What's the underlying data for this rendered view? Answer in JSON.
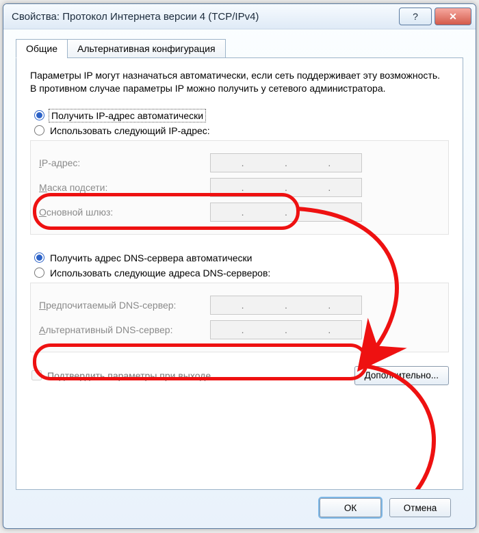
{
  "window": {
    "title": "Свойства: Протокол Интернета версии 4 (TCP/IPv4)"
  },
  "tabs": {
    "general": "Общие",
    "alt": "Альтернативная конфигурация"
  },
  "intro": "Параметры IP могут назначаться автоматически, если сеть поддерживает эту возможность. В противном случае параметры IP можно получить у сетевого администратора.",
  "ip": {
    "auto_label_pre": "П",
    "auto_label_rest": "олучить IP-адрес автоматически",
    "manual_label_pre": "И",
    "manual_label_rest": "спользовать следующий IP-адрес:",
    "ip_label_pre": "I",
    "ip_label_rest": "P-адрес:",
    "mask_label_pre": "М",
    "mask_label_rest": "аска подсети:",
    "gw_label_pre": "О",
    "gw_label_rest": "сновной шлюз:"
  },
  "dns": {
    "auto_label_pre": "П",
    "auto_label_rest": "олучить адрес DNS-сервера автоматически",
    "manual_label_pre": "И",
    "manual_label_rest": "спользовать следующие адреса DNS-серверов:",
    "pref_label_pre": "П",
    "pref_label_rest": "редпочитаемый DNS-сервер:",
    "alt_label_pre": "А",
    "alt_label_rest": "льтернативный DNS-сервер:"
  },
  "validate": {
    "pre": "П",
    "mid": "одтвердить параметры при в",
    "u": "ы",
    "rest": "ходе"
  },
  "buttons": {
    "advanced_pre": "Д",
    "advanced_rest": "ополнительно...",
    "ok": "ОК",
    "cancel": "Отмена"
  }
}
